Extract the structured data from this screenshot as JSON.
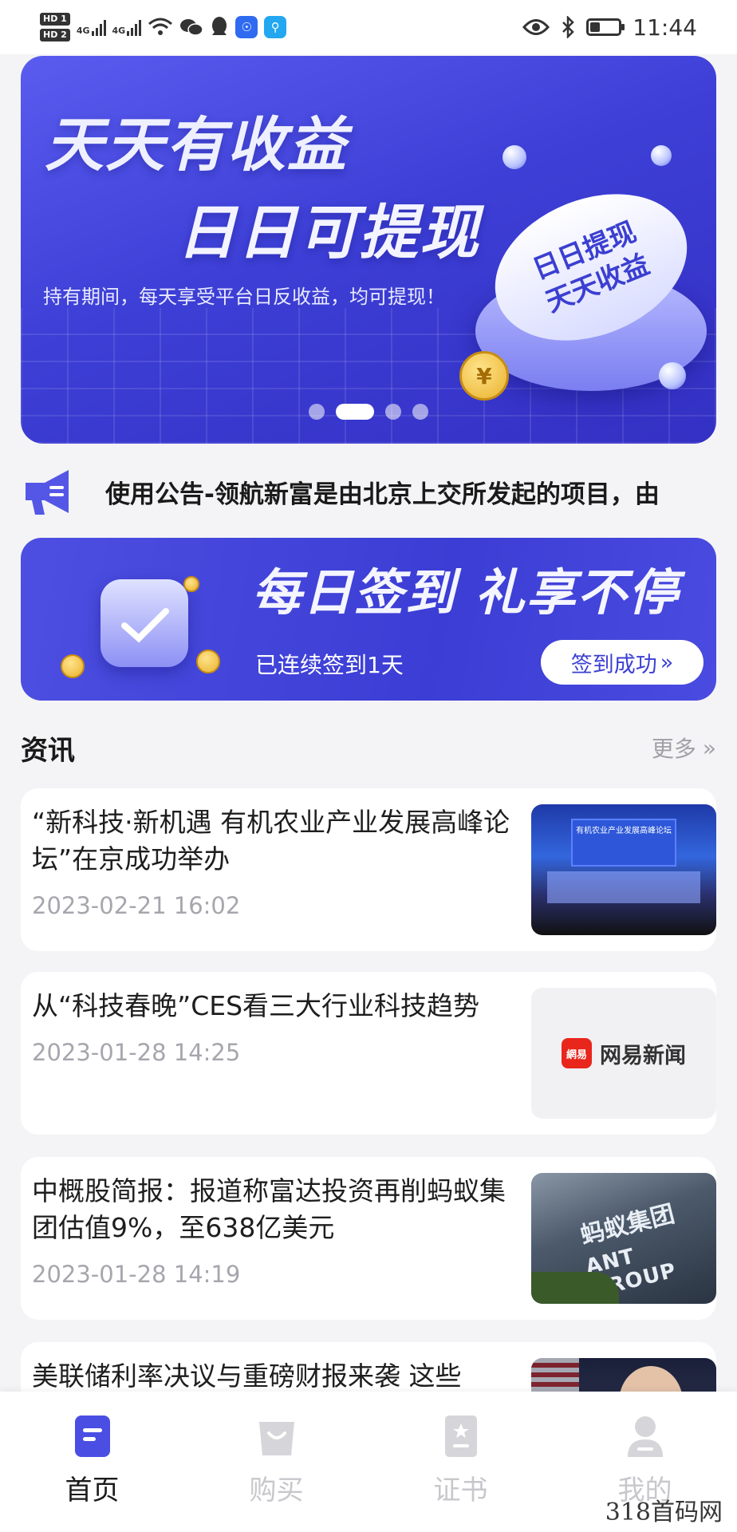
{
  "status_bar": {
    "hd1": "HD 1",
    "hd2": "HD 2",
    "net1": "4G",
    "net2": "4G",
    "time": "11:44",
    "icons": [
      "wifi-icon",
      "wechat-icon",
      "qq-icon",
      "bulb-app-icon",
      "search-app-icon",
      "eye-icon",
      "bluetooth-icon",
      "battery-icon"
    ]
  },
  "hero": {
    "line1": "天天有收益",
    "line2": "日日可提现",
    "subtitle": "持有期间，每天享受平台日反收益，均可提现！",
    "button_line1": "日日提现",
    "button_line2": "天天收益",
    "coin_symbol": "¥",
    "slides": 4,
    "active_slide": 2
  },
  "notice": {
    "text": "使用公告-领航新富是由北京上交所发起的项目，由"
  },
  "checkin": {
    "title": "每日签到 礼享不停",
    "streak_text": "已连续签到1天",
    "button_label": "签到成功",
    "button_arrows": "»"
  },
  "news": {
    "section_title": "资讯",
    "more_label": "更多",
    "more_arrows": "»",
    "items": [
      {
        "title": "“新科技·新机遇 有机农业产业发展高峰论坛”在京成功举办",
        "date": "2023-02-21 16:02",
        "thumb_caption": "有机农业产业发展高峰论坛"
      },
      {
        "title": "从“科技春晚”CES看三大行业科技趋势",
        "date": "2023-01-28 14:25",
        "thumb_logo": "網易",
        "thumb_brand": "网易新闻"
      },
      {
        "title": "中概股简报：报道称富达投资再削蚂蚁集团估值9%，至638亿美元",
        "date": "2023-01-28 14:19",
        "thumb_cn": "蚂蚁集团",
        "thumb_en": "ANT GROUP"
      },
      {
        "title": "美联储利率决议与重磅财报来袭 这些",
        "date": ""
      }
    ]
  },
  "tabs": [
    {
      "label": "首页",
      "icon": "home-doc-icon",
      "active": true
    },
    {
      "label": "购买",
      "icon": "shopping-bag-icon",
      "active": false
    },
    {
      "label": "证书",
      "icon": "certificate-icon",
      "active": false
    },
    {
      "label": "我的",
      "icon": "profile-icon",
      "active": false
    }
  ],
  "watermark": "318首码网",
  "colors": {
    "brand": "#3d3fd6",
    "tab_active": "#4a4ee3",
    "tab_inactive": "#c7c7cc",
    "date_gray": "#a6a6ae"
  }
}
